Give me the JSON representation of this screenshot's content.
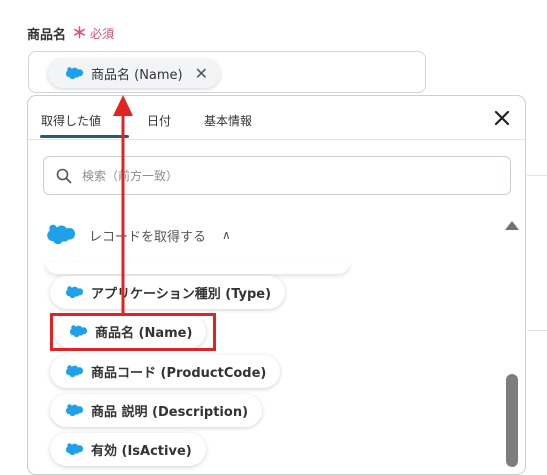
{
  "field": {
    "label": "商品名",
    "required_mark": "＊",
    "required_text": "必須",
    "selected_chip": "商品名 (Name)",
    "remove_symbol": "✕"
  },
  "panel": {
    "tabs": [
      {
        "label": "取得した値",
        "active": true
      },
      {
        "label": "日付",
        "active": false
      },
      {
        "label": "基本情報",
        "active": false
      }
    ],
    "search_placeholder": "検索（前方一致）",
    "section_label": "レコードを取得する",
    "section_caret": "∧",
    "items": [
      {
        "label": "アプリケーション種別 (Type)"
      },
      {
        "label": "商品名 (Name)",
        "highlighted": true
      },
      {
        "label": "商品コード (ProductCode)"
      },
      {
        "label": "商品 説明 (Description)"
      },
      {
        "label": "有効 (IsActive)"
      }
    ]
  },
  "colors": {
    "brand_cloud": "#1ea1e8",
    "accent_tab": "#255e6b",
    "annotation_red": "#e02424",
    "required": "#e0506a"
  },
  "icons": {
    "salesforce": "salesforce-cloud-icon",
    "search": "search-icon",
    "close": "close-icon",
    "remove": "remove-chip-icon"
  }
}
